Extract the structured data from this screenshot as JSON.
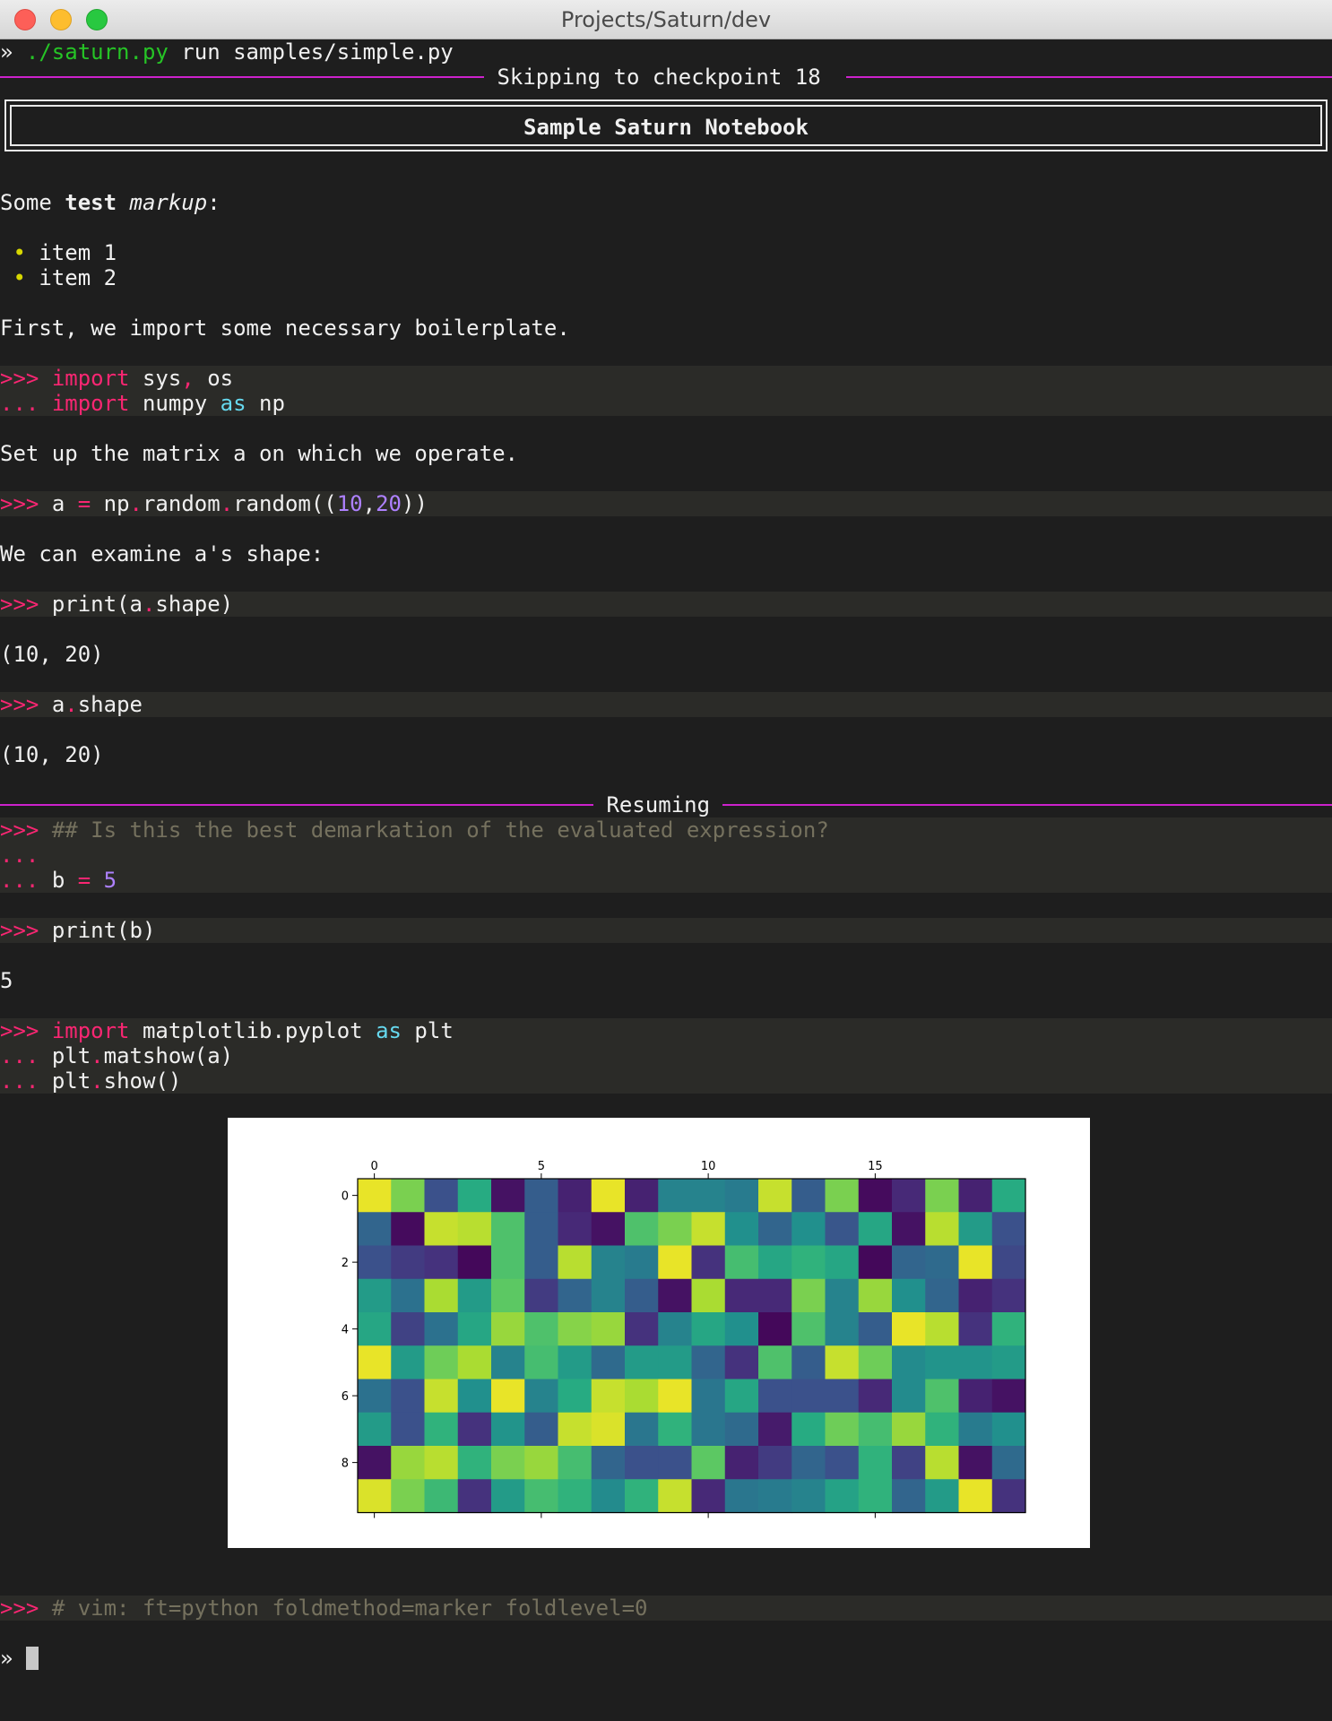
{
  "window": {
    "title": "Projects/Saturn/dev"
  },
  "terminal": {
    "command_prompt": "»",
    "command_script": "./saturn.py",
    "command_args": " run samples/simple.py",
    "checkpoint_banner": " Skipping to checkpoint 18 ",
    "notebook_title": "Sample Saturn Notebook",
    "markup_intro": {
      "plain": "Some ",
      "bold": "test",
      "italic": "markup",
      "colon": ":"
    },
    "list_items": [
      "item 1",
      "item 2"
    ],
    "bullet_glyph": "•",
    "para_boilerplate": "First, we import some necessary boilerplate.",
    "code1": {
      "l1_prompt": ">>>",
      "l1_kw": "import",
      "l1_a": " sys",
      "l1_comma": ",",
      "l1_b": " os",
      "l2_prompt": "...",
      "l2_kw": "import",
      "l2_mod": " numpy ",
      "l2_as": "as",
      "l2_alias": " np"
    },
    "para_matrix": "Set up the matrix a on which we operate.",
    "code2": {
      "prompt": ">>>",
      "a": "a ",
      "eq": "=",
      "np": " np",
      "dot1": ".",
      "random1": "random",
      "dot2": ".",
      "random2": "random((",
      "n1": "10",
      "comma": ",",
      "n2": "20",
      "close": "))"
    },
    "para_shape": "We can examine a's shape:",
    "code3": {
      "prompt": ">>>",
      "pre": "print(a",
      "dot": ".",
      "post": "shape)"
    },
    "output1": "(10, 20)",
    "code4": {
      "prompt": ">>>",
      "pre": "a",
      "dot": ".",
      "post": "shape"
    },
    "output2": "(10, 20)",
    "resuming_banner": " Resuming ",
    "code5": {
      "l1_prompt": ">>>",
      "l1_comment": "## Is this the best demarkation of the evaluated expression?",
      "l2_prompt": "...",
      "l3_prompt": "...",
      "l3_b": "b ",
      "l3_eq": "=",
      "l3_num": "5"
    },
    "code6": {
      "prompt": ">>>",
      "text": "print(b)"
    },
    "output3": "5",
    "code7": {
      "l1_prompt": ">>>",
      "l1_kw": "import",
      "l1_mod": " matplotlib.pyplot ",
      "l1_as": "as",
      "l1_alias": " plt",
      "l2_prompt": "...",
      "l2_pre": "plt",
      "l2_dot": ".",
      "l2_post": "matshow(a)",
      "l3_prompt": "...",
      "l3_pre": "plt",
      "l3_dot": ".",
      "l3_post": "show()"
    },
    "code8": {
      "prompt": ">>>",
      "comment": "# vim: ft=python foldmethod=marker foldlevel=0"
    },
    "final_prompt": "»"
  },
  "colors": {
    "prompt": "#f92672",
    "keyword": "#f92672",
    "as_keyword": "#66d9ef",
    "number": "#ae81ff",
    "comment": "#75715e",
    "script": "#26c426",
    "banner_rule": "#cc22cc",
    "bullet": "#d7d700"
  },
  "chart_data": {
    "type": "heatmap",
    "colormap": "viridis",
    "x_ticks": [
      0,
      5,
      10,
      15
    ],
    "y_ticks": [
      0,
      2,
      4,
      6,
      8
    ],
    "xlim": [
      -0.5,
      19.5
    ],
    "ylim": [
      9.5,
      -0.5
    ],
    "x_axis_position": "top",
    "grid": false,
    "values": [
      [
        0.97,
        0.8,
        0.25,
        0.62,
        0.05,
        0.3,
        0.1,
        0.97,
        0.1,
        0.45,
        0.45,
        0.42,
        0.92,
        0.3,
        0.8,
        0.03,
        0.12,
        0.8,
        0.1,
        0.62
      ],
      [
        0.33,
        0.03,
        0.92,
        0.9,
        0.72,
        0.3,
        0.12,
        0.05,
        0.72,
        0.8,
        0.92,
        0.5,
        0.33,
        0.5,
        0.27,
        0.6,
        0.05,
        0.9,
        0.55,
        0.25
      ],
      [
        0.25,
        0.18,
        0.15,
        0.02,
        0.72,
        0.3,
        0.9,
        0.45,
        0.42,
        0.97,
        0.15,
        0.7,
        0.6,
        0.65,
        0.6,
        0.02,
        0.33,
        0.35,
        0.97,
        0.22
      ],
      [
        0.55,
        0.38,
        0.88,
        0.55,
        0.75,
        0.18,
        0.33,
        0.45,
        0.3,
        0.05,
        0.88,
        0.12,
        0.12,
        0.8,
        0.45,
        0.85,
        0.5,
        0.33,
        0.1,
        0.15
      ],
      [
        0.6,
        0.2,
        0.38,
        0.6,
        0.85,
        0.72,
        0.82,
        0.85,
        0.15,
        0.45,
        0.6,
        0.5,
        0.02,
        0.72,
        0.45,
        0.3,
        0.97,
        0.9,
        0.15,
        0.65
      ],
      [
        0.97,
        0.55,
        0.78,
        0.88,
        0.45,
        0.7,
        0.55,
        0.35,
        0.55,
        0.55,
        0.33,
        0.15,
        0.72,
        0.3,
        0.92,
        0.78,
        0.48,
        0.52,
        0.52,
        0.55
      ],
      [
        0.38,
        0.25,
        0.92,
        0.5,
        0.97,
        0.45,
        0.62,
        0.92,
        0.88,
        0.97,
        0.4,
        0.6,
        0.25,
        0.25,
        0.25,
        0.12,
        0.48,
        0.72,
        0.1,
        0.05
      ],
      [
        0.55,
        0.25,
        0.65,
        0.15,
        0.52,
        0.3,
        0.92,
        0.95,
        0.4,
        0.65,
        0.4,
        0.35,
        0.08,
        0.62,
        0.78,
        0.7,
        0.85,
        0.65,
        0.42,
        0.5
      ],
      [
        0.05,
        0.85,
        0.9,
        0.65,
        0.8,
        0.85,
        0.7,
        0.33,
        0.25,
        0.25,
        0.75,
        0.1,
        0.18,
        0.33,
        0.25,
        0.65,
        0.2,
        0.9,
        0.05,
        0.35
      ],
      [
        0.95,
        0.8,
        0.68,
        0.15,
        0.55,
        0.7,
        0.65,
        0.48,
        0.65,
        0.92,
        0.12,
        0.4,
        0.42,
        0.45,
        0.58,
        0.65,
        0.33,
        0.55,
        0.97,
        0.15
      ]
    ]
  }
}
